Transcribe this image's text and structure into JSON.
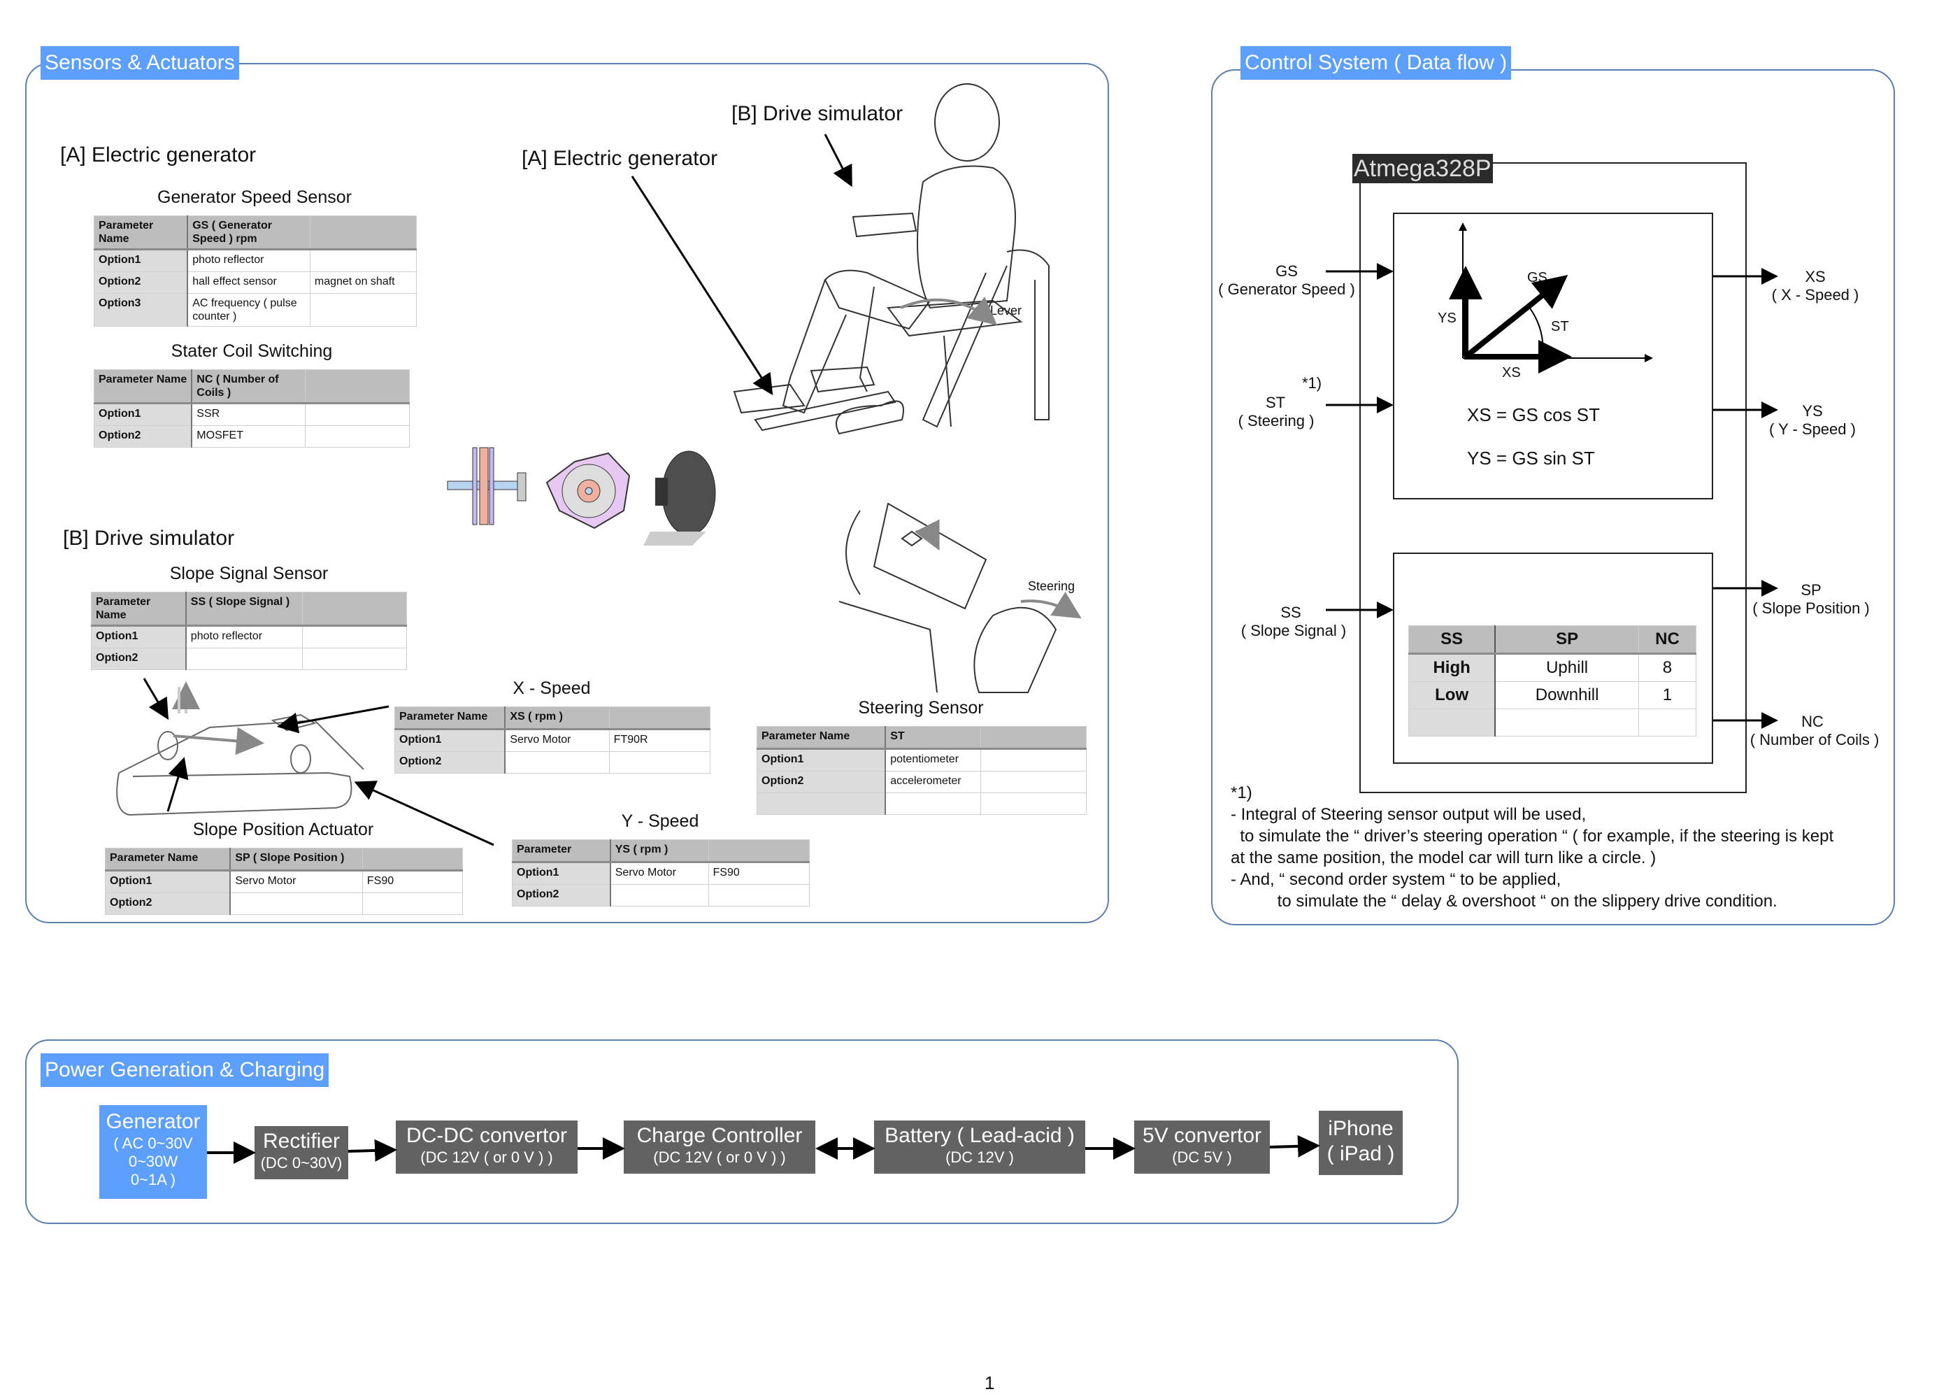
{
  "sensors_panel": {
    "title": "Sensors & Actuators",
    "section_a_label": "[A] Electric generator",
    "section_b_label": "[B] Drive simulator",
    "illustration_labels": {
      "drive_simulator": "[B] Drive simulator",
      "electric_generator": "[A] Electric generator",
      "lever": "Lever",
      "steering": "Steering"
    },
    "generator_speed_sensor": {
      "title": "Generator Speed Sensor",
      "header": [
        "Parameter Name",
        "GS ( Generator Speed ) rpm",
        ""
      ],
      "rows": [
        [
          "Option1",
          "photo reflector",
          ""
        ],
        [
          "Option2",
          "hall effect sensor",
          "magnet on shaft"
        ],
        [
          "Option3",
          "AC frequency ( pulse counter )",
          ""
        ]
      ]
    },
    "stater_coil_switching": {
      "title": "Stater Coil Switching",
      "header": [
        "Parameter Name",
        "NC ( Number of Coils )",
        ""
      ],
      "rows": [
        [
          "Option1",
          "SSR",
          ""
        ],
        [
          "Option2",
          "MOSFET",
          ""
        ]
      ]
    },
    "slope_signal_sensor": {
      "title": "Slope Signal Sensor",
      "header": [
        "Parameter Name",
        "SS ( Slope Signal )",
        ""
      ],
      "rows": [
        [
          "Option1",
          "photo reflector",
          ""
        ],
        [
          "Option2",
          "",
          ""
        ]
      ]
    },
    "x_speed": {
      "title": "X - Speed",
      "header": [
        "Parameter Name",
        "XS ( rpm )",
        ""
      ],
      "rows": [
        [
          "Option1",
          "Servo Motor",
          "FT90R"
        ],
        [
          "Option2",
          "",
          ""
        ]
      ]
    },
    "steering_sensor": {
      "title": "Steering Sensor",
      "header": [
        "Parameter Name",
        "ST",
        ""
      ],
      "rows": [
        [
          "Option1",
          "potentiometer",
          ""
        ],
        [
          "Option2",
          "accelerometer",
          ""
        ],
        [
          "",
          "",
          ""
        ]
      ]
    },
    "slope_position_actuator": {
      "title": "Slope Position Actuator",
      "header": [
        "Parameter Name",
        "SP ( Slope Position )",
        ""
      ],
      "rows": [
        [
          "Option1",
          "Servo Motor",
          "FS90"
        ],
        [
          "Option2",
          "",
          ""
        ]
      ]
    },
    "y_speed": {
      "title": "Y - Speed",
      "header": [
        "Parameter",
        "YS ( rpm )",
        ""
      ],
      "rows": [
        [
          "Option1",
          "Servo Motor",
          "FS90"
        ],
        [
          "Option2",
          "",
          ""
        ]
      ]
    }
  },
  "control_panel": {
    "title": "Control System ( Data flow )",
    "mcu_label": "Atmega328P",
    "inputs": {
      "gs": {
        "code": "GS",
        "desc": "( Generator Speed )"
      },
      "st": {
        "code": "ST",
        "desc": "( Steering )",
        "note_ref": "*1)"
      },
      "ss": {
        "code": "SS",
        "desc": "( Slope Signal )"
      }
    },
    "outputs": {
      "xs": {
        "code": "XS",
        "desc": "( X - Speed )"
      },
      "ys": {
        "code": "YS",
        "desc": "( Y - Speed )"
      },
      "sp": {
        "code": "SP",
        "desc": "( Slope Position )"
      },
      "nc": {
        "code": "NC",
        "desc": "( Number of Coils )"
      }
    },
    "vector_diagram": {
      "gs": "GS",
      "ys": "YS",
      "xs": "XS",
      "st": "ST"
    },
    "formulas": [
      "XS = GS cos ST",
      "YS = GS sin ST"
    ],
    "logic_table": {
      "header": [
        "SS",
        "SP",
        "NC"
      ],
      "rows": [
        [
          "High",
          "Uphill",
          "8"
        ],
        [
          "Low",
          "Downhill",
          "1"
        ],
        [
          "",
          "",
          ""
        ]
      ]
    },
    "footnote": {
      "ref": "*1)",
      "lines": [
        "- Integral of Steering sensor output will be used,",
        "  to simulate the “ driver’s steering operation “ ( for example, if the steering is kept",
        "at the same position, the model car will turn like a circle. )",
        "- And, “ second order system “ to be applied,",
        "          to simulate the “ delay & overshoot “ on the slippery drive condition."
      ]
    }
  },
  "power_panel": {
    "title": "Power Generation & Charging",
    "blocks": [
      {
        "title": "Generator",
        "sub": [
          "( AC 0~30V",
          "0~30W",
          "0~1A )"
        ]
      },
      {
        "title": "Rectifier",
        "sub": [
          "(DC 0~30V)"
        ]
      },
      {
        "title": "DC-DC convertor",
        "sub": [
          "(DC 12V ( or 0 V ) )"
        ]
      },
      {
        "title": "Charge Controller",
        "sub": [
          "(DC 12V ( or 0 V ) )"
        ]
      },
      {
        "title": "Battery ( Lead-acid )",
        "sub": [
          "(DC 12V )"
        ]
      },
      {
        "title": "5V convertor",
        "sub": [
          "(DC 5V )"
        ]
      },
      {
        "title": "iPhone",
        "sub": [
          "( iPad )"
        ]
      }
    ],
    "connections": [
      "one-way",
      "one-way",
      "one-way",
      "two-way",
      "one-way",
      "one-way"
    ]
  },
  "colors": {
    "accent": "#5c9ffd",
    "panel_border": "#5b7fae",
    "block_dark": "#626262",
    "mcu_label_bg": "#2b2b2b"
  },
  "page_number": "1"
}
